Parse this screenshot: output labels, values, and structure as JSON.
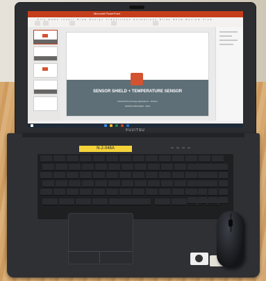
{
  "screen": {
    "window_title": "Microsoft PowerPoint",
    "ribbon_tabs": "File  Home  Insert  Draw  Design  Transitions  Animations  Slide Show  Review  View",
    "slide": {
      "title": "SENSOR SHIELD + TEMPERATURE SENSOR",
      "subtitle": "Industrial Technology Applications · Arduino",
      "subtitle2": "NORTH MIDLANDS · 2021"
    }
  },
  "laptop": {
    "brand": "FUJITSU",
    "sticker_text": "N-2-048A"
  },
  "colors": {
    "powerpoint_accent": "#c43e1c",
    "slide_band": "#5f6f78",
    "sticker": "#f4d23a"
  },
  "icons": [
    "webcam-icon",
    "powerpoint-logo-icon",
    "windows-key-icon",
    "mouse-icon"
  ]
}
